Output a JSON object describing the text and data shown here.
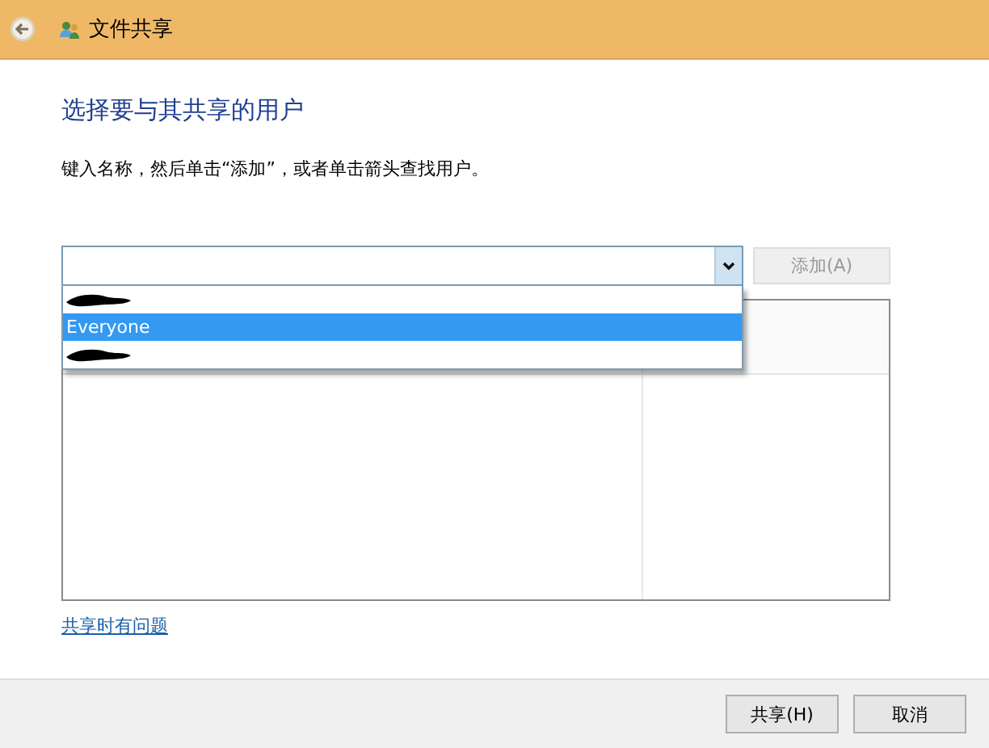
{
  "window": {
    "title": "文件共享"
  },
  "heading": "选择要与其共享的用户",
  "instruction": "键入名称，然后单击“添加”，或者单击箭头查找用户。",
  "name_combo": {
    "expanded": true,
    "options": [
      {
        "kind": "redacted",
        "selected": false
      },
      {
        "kind": "text",
        "label": "Everyone",
        "selected": true
      },
      {
        "kind": "redacted",
        "selected": false
      }
    ]
  },
  "add_button": {
    "label": "添加(A)",
    "disabled": true
  },
  "help_link": "共享时有问题",
  "buttons": [
    {
      "label": "共享(H)"
    },
    {
      "label": "取消"
    }
  ]
}
